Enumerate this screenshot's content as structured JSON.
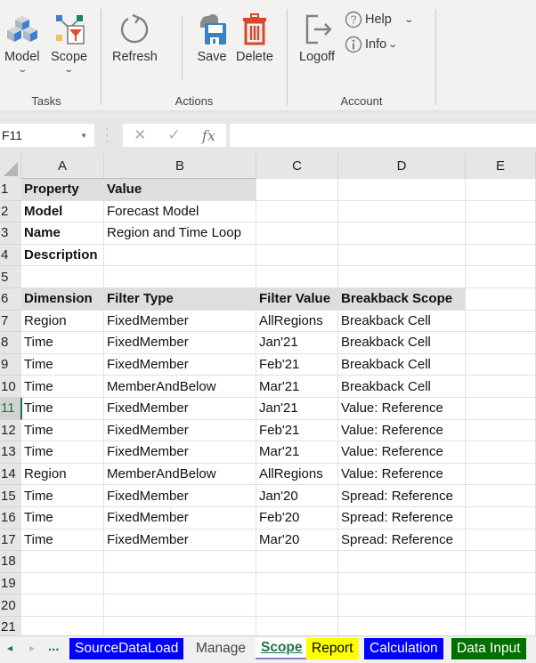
{
  "ribbon": {
    "groups": [
      {
        "label": "Tasks",
        "buttons": [
          {
            "label": "Model",
            "icon": "model-cubes-icon",
            "has_dropdown": true
          },
          {
            "label": "Scope",
            "icon": "scope-filter-icon",
            "has_dropdown": true
          }
        ]
      },
      {
        "label": "Actions",
        "buttons": [
          {
            "label": "Refresh",
            "icon": "refresh-icon"
          },
          {
            "label": "Save",
            "icon": "save-cloud-icon"
          },
          {
            "label": "Delete",
            "icon": "trash-icon"
          }
        ]
      },
      {
        "label": "Account",
        "buttons": [
          {
            "label": "Logoff",
            "icon": "logoff-icon"
          },
          {
            "label": "Help",
            "icon": "question-circle-icon",
            "has_dropdown": true
          },
          {
            "label": "Info",
            "icon": "info-circle-icon",
            "has_dropdown": true
          }
        ]
      }
    ],
    "dropdown_glyph": "⌄",
    "colors": {
      "model_blue": "#3c7fcf",
      "delete_red": "#d9472b",
      "save_blue": "#3d7fc4",
      "scope_green": "#0f8a5f",
      "scope_yellow": "#f4c15d"
    }
  },
  "formula_bar": {
    "name_box": "F11",
    "cancel_glyph": "✕",
    "enter_glyph": "✓",
    "fx_label": "fx",
    "formula": ""
  },
  "grid": {
    "columns": [
      "A",
      "B",
      "C",
      "D",
      "E"
    ],
    "row_numbers": [
      "1",
      "2",
      "3",
      "4",
      "5",
      "6",
      "7",
      "8",
      "9",
      "10",
      "11",
      "12",
      "13",
      "14",
      "15",
      "16",
      "17",
      "18",
      "19",
      "20",
      "21"
    ],
    "active_row": "11",
    "properties": {
      "header": [
        "Property",
        "Value"
      ],
      "rows": [
        [
          "Model",
          "Forecast Model"
        ],
        [
          "Name",
          "Region and Time Loop"
        ],
        [
          "Description",
          ""
        ]
      ]
    },
    "dimensions": {
      "header": [
        "Dimension",
        "Filter Type",
        "Filter Value",
        "Breakback Scope"
      ],
      "rows": [
        [
          "Region",
          "FixedMember",
          "AllRegions",
          "Breakback Cell"
        ],
        [
          "Time",
          "FixedMember",
          "Jan'21",
          "Breakback Cell"
        ],
        [
          "Time",
          "FixedMember",
          "Feb'21",
          "Breakback Cell"
        ],
        [
          "Time",
          "MemberAndBelow",
          "Mar'21",
          "Breakback Cell"
        ],
        [
          "Time",
          "FixedMember",
          "Jan'21",
          "Value: Reference"
        ],
        [
          "Time",
          "FixedMember",
          "Feb'21",
          "Value: Reference"
        ],
        [
          "Time",
          "FixedMember",
          "Mar'21",
          "Value: Reference"
        ],
        [
          "Region",
          "MemberAndBelow",
          "AllRegions",
          "Value: Reference"
        ],
        [
          "Time",
          "FixedMember",
          "Jan'20",
          "Spread: Reference"
        ],
        [
          "Time",
          "FixedMember",
          "Feb'20",
          "Spread: Reference"
        ],
        [
          "Time",
          "FixedMember",
          "Mar'20",
          "Spread: Reference"
        ]
      ]
    }
  },
  "sheet_tabs": {
    "prev_glyph": "◂",
    "next_glyph": "▸",
    "more_label": "...",
    "tabs": [
      {
        "label": "SourceDataLoad",
        "bg": "#0000ff",
        "fg": "#ffffff",
        "active": false
      },
      {
        "label": "Manage",
        "bg": "#f0f0f0",
        "fg": "#444444",
        "active": false
      },
      {
        "label": "Scope",
        "bg": "#ffffff",
        "fg": "#217346",
        "active": true
      },
      {
        "label": "Report",
        "bg": "#ffff00",
        "fg": "#000000",
        "active": false
      },
      {
        "label": "Calculation",
        "bg": "#0000ff",
        "fg": "#ffffff",
        "active": false
      },
      {
        "label": "Data Input",
        "bg": "#007000",
        "fg": "#ffffff",
        "active": false
      }
    ]
  }
}
